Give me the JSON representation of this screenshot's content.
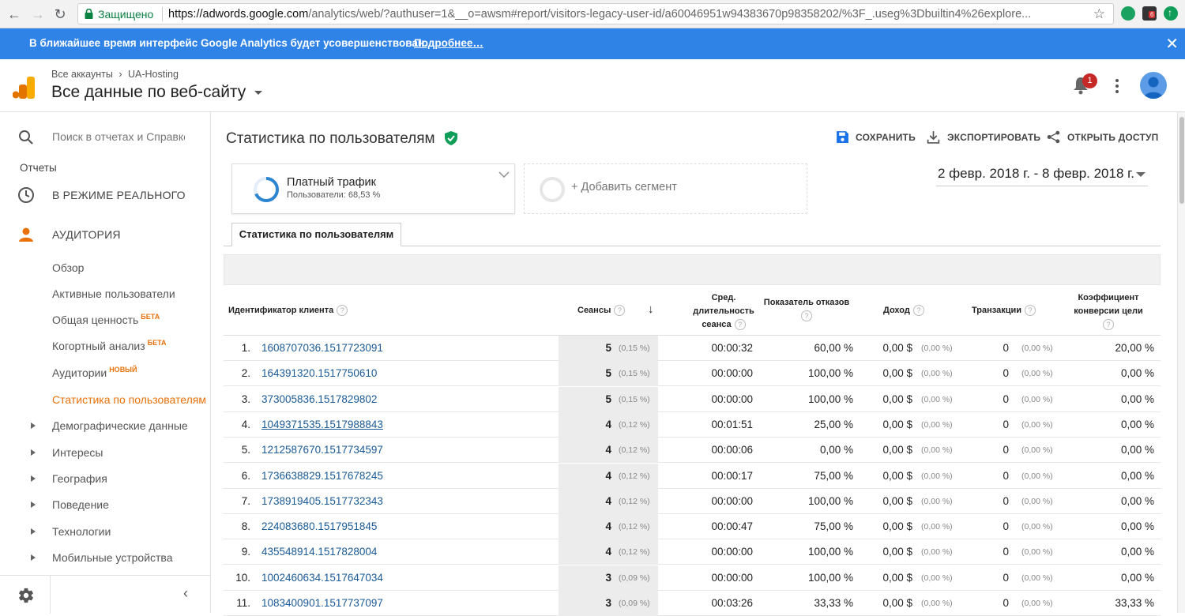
{
  "browser": {
    "secure_label": "Защищено",
    "url_host": "https://adwords.google.com",
    "url_path": "/analytics/web/?authuser=1&__o=awsm#report/visitors-legacy-user-id/a60046951w94383670p98358202/%3F_.useg%3Dbuiltin4%26explore...",
    "ext_badge": "6"
  },
  "banner": {
    "text": "В ближайшее время интерфейс Google Analytics будет усовершенствован.",
    "link": "Подробнее…",
    "close": "✕"
  },
  "header": {
    "crumb_root": "Все аккаунты",
    "crumb_sep": "›",
    "crumb_account": "UA-Hosting",
    "property": "Все данные по веб-сайту",
    "notifications_count": "1"
  },
  "sidebar": {
    "search_placeholder": "Поиск в отчетах и Справке",
    "reports_label": "Отчеты",
    "realtime": "В РЕЖИМЕ РЕАЛЬНОГО",
    "audience": "АУДИТОРИЯ",
    "items": [
      {
        "label": "Обзор",
        "badge": ""
      },
      {
        "label": "Активные пользователи",
        "badge": ""
      },
      {
        "label": "Общая ценность",
        "badge": "БЕТА"
      },
      {
        "label": "Когортный анализ",
        "badge": "БЕТА"
      },
      {
        "label": "Аудитории",
        "badge": "НОВЫЙ"
      },
      {
        "label": "Статистика по пользователям",
        "badge": ""
      }
    ],
    "groups": [
      "Демографические данные",
      "Интересы",
      "География",
      "Поведение",
      "Технологии",
      "Мобильные устройства"
    ]
  },
  "report": {
    "title": "Статистика по пользователям",
    "save": "СОХРАНИТЬ",
    "export": "ЭКСПОРТИРОВАТЬ",
    "share": "ОТКРЫТЬ ДОСТУП",
    "date_range": "2 февр. 2018 г. - 8 февр. 2018 г.",
    "segment": {
      "name": "Платный трафик",
      "sub": "Пользователи: 68,53 %",
      "share": 0.6853
    },
    "add_segment": "+ Добавить сегмент",
    "tab": "Статистика по пользователям"
  },
  "table": {
    "columns": {
      "client_id": "Идентификатор клиента",
      "sessions": "Сеансы",
      "avg_dur_1": "Сред.",
      "avg_dur_2": "длительность",
      "avg_dur_3": "сеанса",
      "bounce": "Показатель отказов",
      "revenue": "Доход",
      "transactions": "Транзакции",
      "conv_1": "Коэффициент",
      "conv_2": "конверсии цели"
    },
    "rows": [
      {
        "idx": "1.",
        "id": "1608707036.1517723091",
        "ses": "5",
        "ses_pct": "(0,15 %)",
        "dur": "00:00:32",
        "bounce": "60,00 %",
        "rev": "0,00 $",
        "rev_pct": "(0,00 %)",
        "tr": "0",
        "tr_pct": "(0,00 %)",
        "conv": "20,00 %"
      },
      {
        "idx": "2.",
        "id": "164391320.1517750610",
        "ses": "5",
        "ses_pct": "(0,15 %)",
        "dur": "00:00:00",
        "bounce": "100,00 %",
        "rev": "0,00 $",
        "rev_pct": "(0,00 %)",
        "tr": "0",
        "tr_pct": "(0,00 %)",
        "conv": "0,00 %"
      },
      {
        "idx": "3.",
        "id": "373005836.1517829802",
        "ses": "5",
        "ses_pct": "(0,15 %)",
        "dur": "00:00:00",
        "bounce": "100,00 %",
        "rev": "0,00 $",
        "rev_pct": "(0,00 %)",
        "tr": "0",
        "tr_pct": "(0,00 %)",
        "conv": "0,00 %"
      },
      {
        "idx": "4.",
        "id": "1049371535.1517988843",
        "ses": "4",
        "ses_pct": "(0,12 %)",
        "dur": "00:01:51",
        "bounce": "25,00 %",
        "rev": "0,00 $",
        "rev_pct": "(0,00 %)",
        "tr": "0",
        "tr_pct": "(0,00 %)",
        "conv": "0,00 %"
      },
      {
        "idx": "5.",
        "id": "1212587670.1517734597",
        "ses": "4",
        "ses_pct": "(0,12 %)",
        "dur": "00:00:06",
        "bounce": "0,00 %",
        "rev": "0,00 $",
        "rev_pct": "(0,00 %)",
        "tr": "0",
        "tr_pct": "(0,00 %)",
        "conv": "0,00 %"
      },
      {
        "idx": "6.",
        "id": "1736638829.1517678245",
        "ses": "4",
        "ses_pct": "(0,12 %)",
        "dur": "00:00:17",
        "bounce": "75,00 %",
        "rev": "0,00 $",
        "rev_pct": "(0,00 %)",
        "tr": "0",
        "tr_pct": "(0,00 %)",
        "conv": "0,00 %"
      },
      {
        "idx": "7.",
        "id": "1738919405.1517732343",
        "ses": "4",
        "ses_pct": "(0,12 %)",
        "dur": "00:00:00",
        "bounce": "100,00 %",
        "rev": "0,00 $",
        "rev_pct": "(0,00 %)",
        "tr": "0",
        "tr_pct": "(0,00 %)",
        "conv": "0,00 %"
      },
      {
        "idx": "8.",
        "id": "224083680.1517951845",
        "ses": "4",
        "ses_pct": "(0,12 %)",
        "dur": "00:00:47",
        "bounce": "75,00 %",
        "rev": "0,00 $",
        "rev_pct": "(0,00 %)",
        "tr": "0",
        "tr_pct": "(0,00 %)",
        "conv": "0,00 %"
      },
      {
        "idx": "9.",
        "id": "435548914.1517828004",
        "ses": "4",
        "ses_pct": "(0,12 %)",
        "dur": "00:00:00",
        "bounce": "100,00 %",
        "rev": "0,00 $",
        "rev_pct": "(0,00 %)",
        "tr": "0",
        "tr_pct": "(0,00 %)",
        "conv": "0,00 %"
      },
      {
        "idx": "10.",
        "id": "1002460634.1517647034",
        "ses": "3",
        "ses_pct": "(0,09 %)",
        "dur": "00:00:00",
        "bounce": "100,00 %",
        "rev": "0,00 $",
        "rev_pct": "(0,00 %)",
        "tr": "0",
        "tr_pct": "(0,00 %)",
        "conv": "0,00 %"
      },
      {
        "idx": "11.",
        "id": "1083400901.1517737097",
        "ses": "3",
        "ses_pct": "(0,09 %)",
        "dur": "00:03:26",
        "bounce": "33,33 %",
        "rev": "0,00 $",
        "rev_pct": "(0,00 %)",
        "tr": "0",
        "tr_pct": "(0,00 %)",
        "conv": "33,33 %"
      }
    ]
  }
}
